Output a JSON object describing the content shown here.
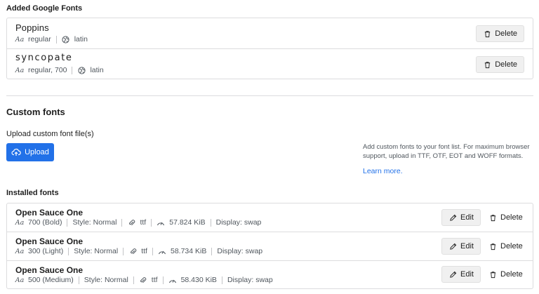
{
  "google_fonts": {
    "title": "Added Google Fonts",
    "items": [
      {
        "name": "Poppins",
        "variants": "regular",
        "subsets": "latin",
        "delete_label": "Delete"
      },
      {
        "name": "syncopate",
        "variants": "regular, 700",
        "subsets": "latin",
        "delete_label": "Delete"
      }
    ]
  },
  "custom": {
    "title": "Custom fonts",
    "upload_label": "Upload custom font file(s)",
    "upload_button": "Upload",
    "help_text": "Add custom fonts to your font list. For maximum browser support, upload in TTF, OTF, EOT and WOFF formats.",
    "learn_more": "Learn more."
  },
  "installed": {
    "title": "Installed fonts",
    "items": [
      {
        "name": "Open Sauce One",
        "weight": "700 (Bold)",
        "style": "Style: Normal",
        "format": "ttf",
        "size": "57.824 KiB",
        "display": "Display: swap",
        "edit_label": "Edit",
        "delete_label": "Delete"
      },
      {
        "name": "Open Sauce One",
        "weight": "300 (Light)",
        "style": "Style: Normal",
        "format": "ttf",
        "size": "58.734 KiB",
        "display": "Display: swap",
        "edit_label": "Edit",
        "delete_label": "Delete"
      },
      {
        "name": "Open Sauce One",
        "weight": "500 (Medium)",
        "style": "Style: Normal",
        "format": "ttf",
        "size": "58.430 KiB",
        "display": "Display: swap",
        "edit_label": "Edit",
        "delete_label": "Delete"
      }
    ]
  },
  "meta_icons": {
    "aa": "Aa"
  },
  "colors": {
    "primary": "#2271e8",
    "border": "#dcdcde"
  }
}
